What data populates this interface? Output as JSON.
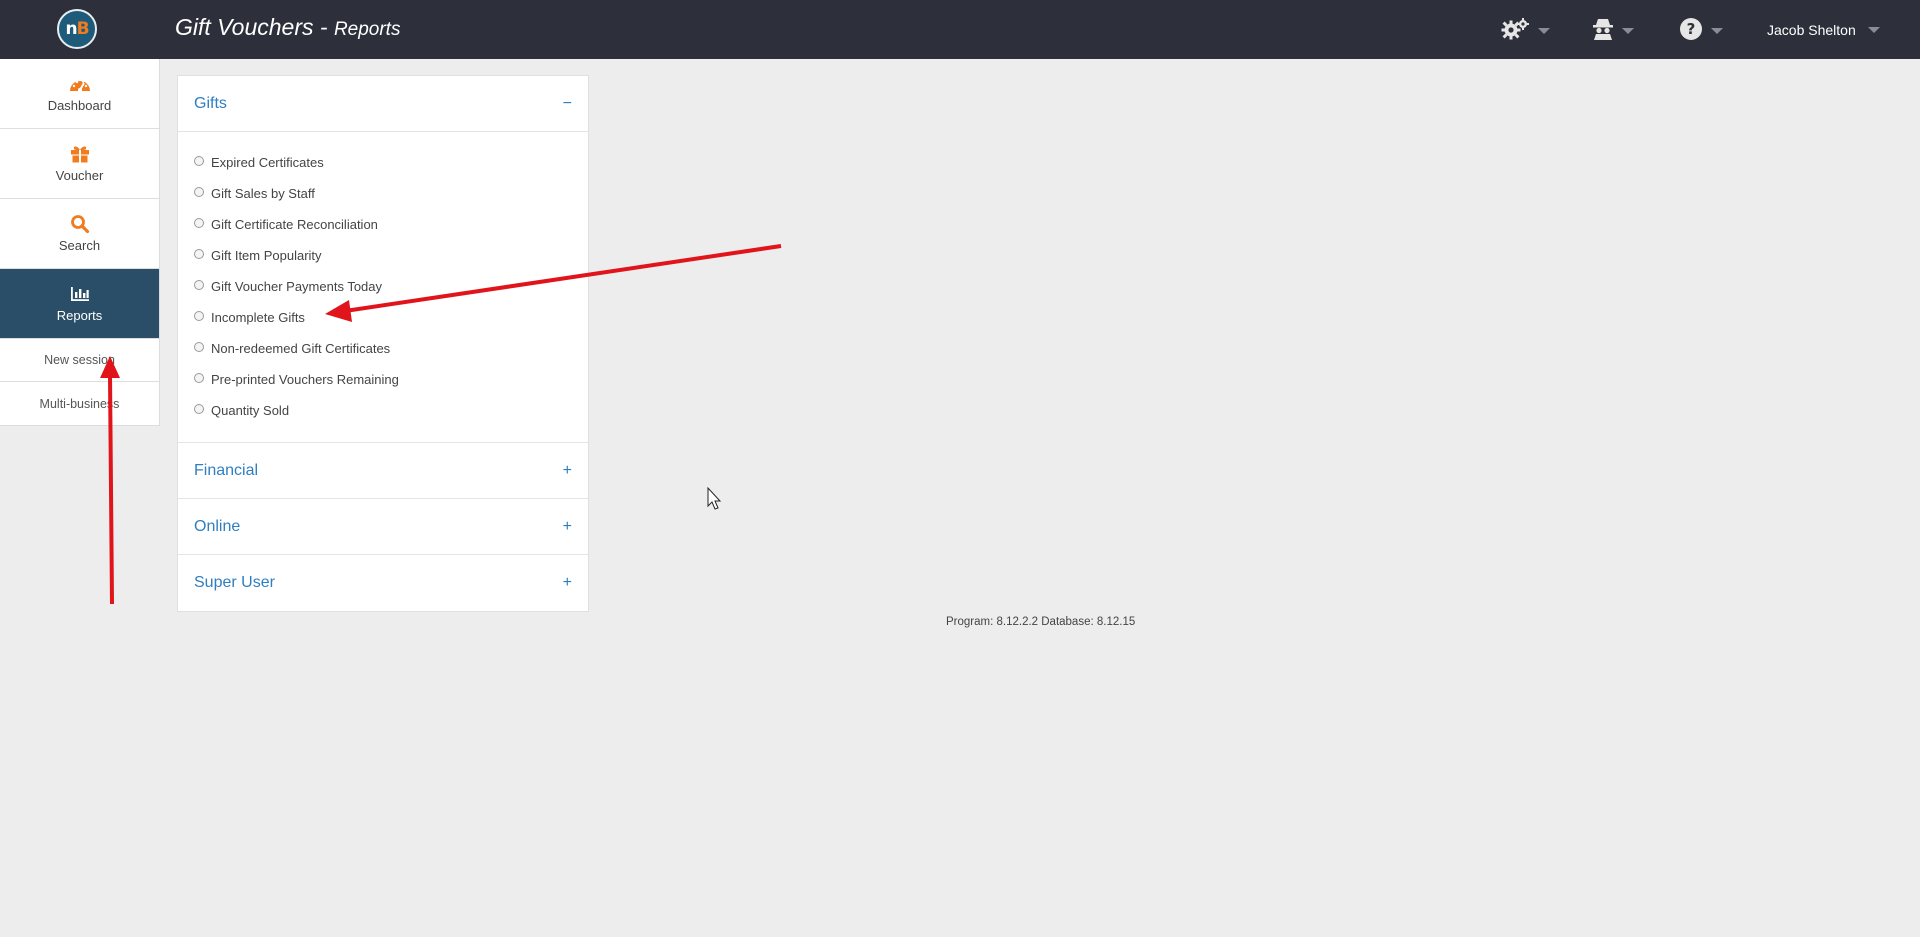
{
  "header": {
    "title": "Gift Vouchers",
    "separator": " - ",
    "subtitle": "Reports",
    "logo": {
      "letter_n": "n",
      "letter_b": "B"
    },
    "icons": [
      "gears-icon",
      "incognito-user-icon",
      "help-circle-icon"
    ],
    "user_name": "Jacob Shelton",
    "colors": {
      "bar": "#2d303a",
      "logo_accent": "#f07c1e"
    }
  },
  "sidebar": {
    "items": [
      {
        "label": "Dashboard",
        "icon": "dashboard-gauge-icon",
        "active": false
      },
      {
        "label": "Voucher",
        "icon": "gift-icon",
        "active": false
      },
      {
        "label": "Search",
        "icon": "search-icon",
        "active": false
      },
      {
        "label": "Reports",
        "icon": "bar-chart-icon",
        "active": true
      }
    ],
    "links": [
      "New session",
      "Multi-business"
    ],
    "colors": {
      "active_bg": "#2a4e68",
      "icon": "#f07c1e"
    }
  },
  "reports": {
    "sections": [
      {
        "title": "Gifts",
        "toggle": "−",
        "expanded": true,
        "options": [
          "Expired Certificates",
          "Gift Sales by Staff",
          "Gift Certificate Reconciliation",
          "Gift Item Popularity",
          "Gift Voucher Payments Today",
          "Incomplete Gifts",
          "Non-redeemed Gift Certificates",
          "Pre-printed Vouchers Remaining",
          "Quantity Sold"
        ]
      },
      {
        "title": "Financial",
        "toggle": "+",
        "expanded": false
      },
      {
        "title": "Online",
        "toggle": "+",
        "expanded": false
      },
      {
        "title": "Super User",
        "toggle": "+",
        "expanded": false
      }
    ],
    "link_color": "#2f7fc0"
  },
  "footer": {
    "version": "Program: 8.12.2.2 Database: 8.12.15"
  },
  "annotations": {
    "arrow_color": "#e0141a"
  }
}
